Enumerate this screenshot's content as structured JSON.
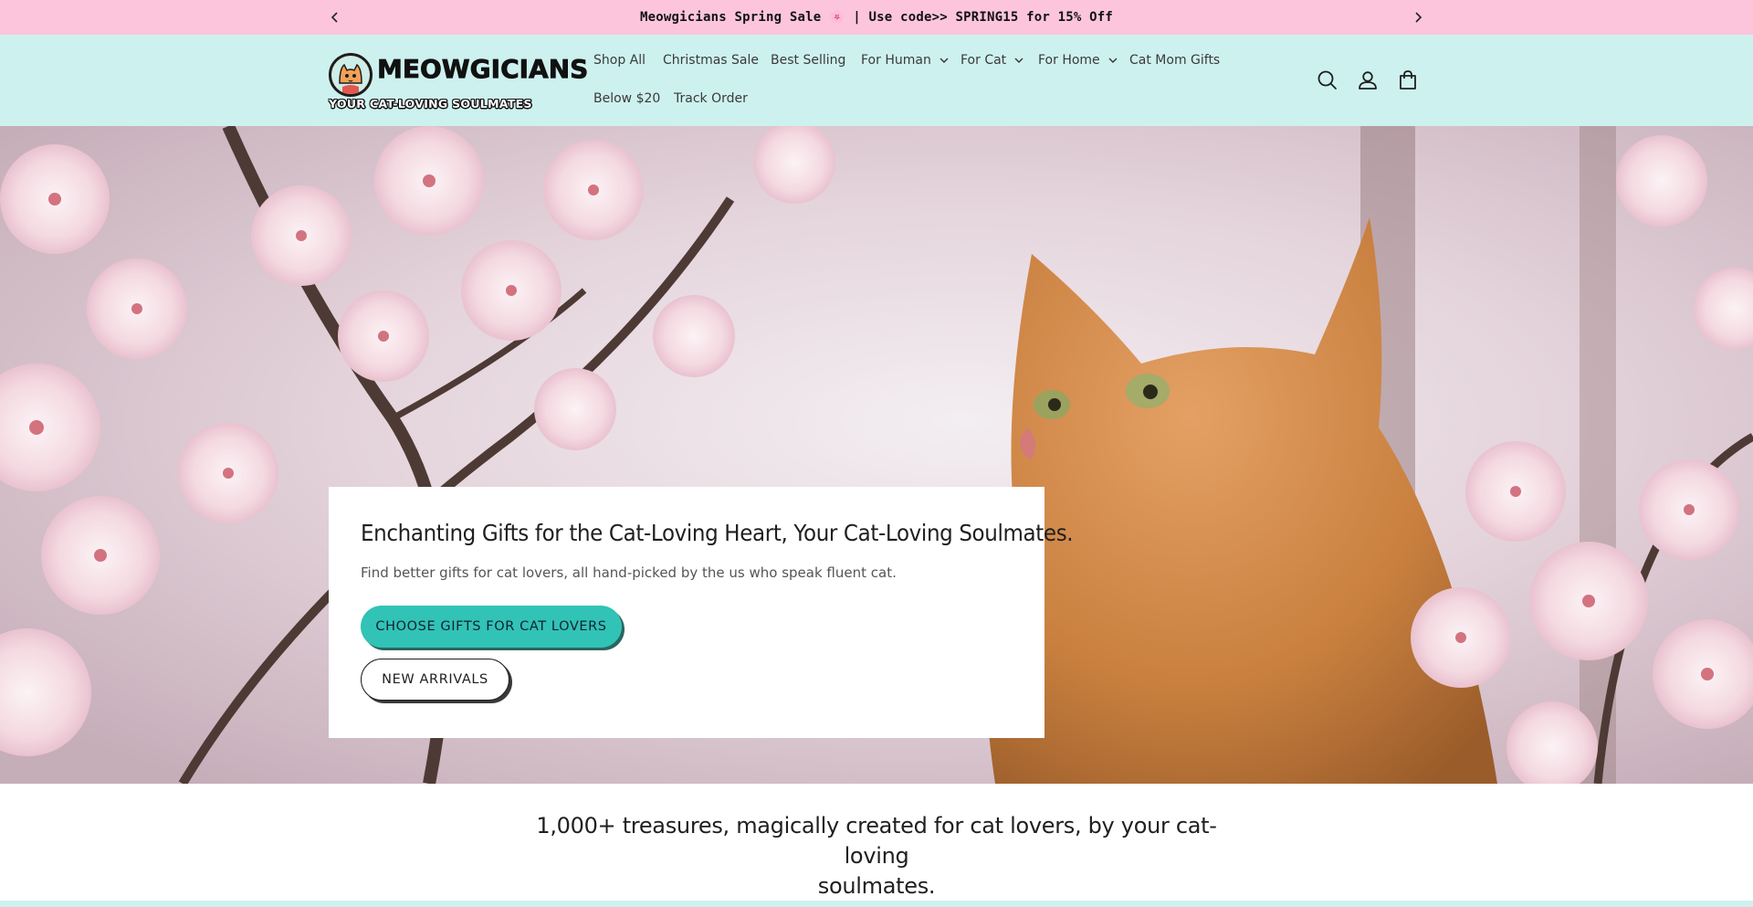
{
  "announcement": {
    "text": "Meowgicians Spring Sale 🌸 | Use code>> SPRING15 for 15% Off",
    "prev_icon": "chevron-left-icon",
    "next_icon": "chevron-right-icon",
    "background": "#fcc5dc"
  },
  "header": {
    "background": "#cdf1ef",
    "logo": {
      "brand": "MEOWGICIANS",
      "tagline": "YOUR CAT-LOVING SOULMATES"
    },
    "nav": [
      {
        "label": "Shop All"
      },
      {
        "label": "Christmas Sale"
      },
      {
        "label": "Best Selling"
      },
      {
        "label": "For Human",
        "dropdown": true
      },
      {
        "label": "For Cat",
        "dropdown": true
      },
      {
        "label": "For Home",
        "dropdown": true
      },
      {
        "label": "Cat Mom Gifts"
      },
      {
        "label": "Below $20"
      },
      {
        "label": "Track Order"
      }
    ],
    "icons": [
      "search-icon",
      "account-icon",
      "cart-icon"
    ]
  },
  "hero": {
    "title": "Enchanting Gifts for the Cat-Loving Heart, Your Cat-Loving Soulmates.",
    "subtitle": "Find better gifts for cat lovers, all hand-picked by the us who speak fluent cat.",
    "primary_button": "CHOOSE GIFTS FOR CAT LOVERS",
    "secondary_button": "NEW ARRIVALS",
    "accent": "#31c3b6"
  },
  "intro": {
    "line1": "1,000+ treasures, magically created for cat lovers, by your cat-loving",
    "line2": "soulmates."
  }
}
